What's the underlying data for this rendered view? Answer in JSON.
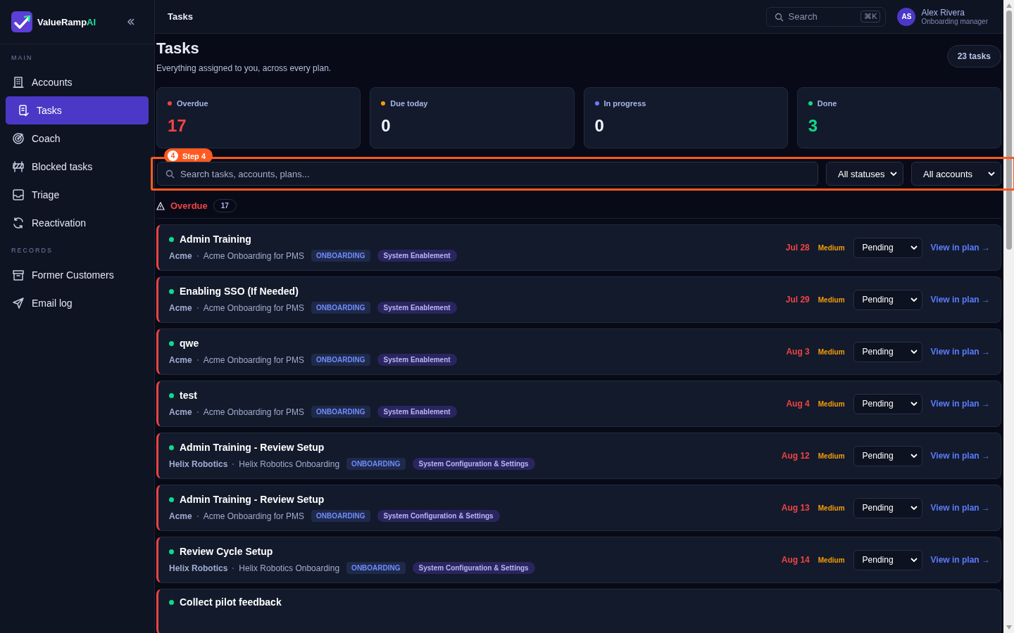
{
  "brand": {
    "name": "ValueRamp",
    "suffix": "AI"
  },
  "sidebar": {
    "sections": [
      {
        "label": "MAIN",
        "items": [
          {
            "label": "Accounts",
            "selected": false
          },
          {
            "label": "Tasks",
            "selected": true
          },
          {
            "label": "Coach",
            "selected": false
          },
          {
            "label": "Blocked tasks",
            "selected": false
          },
          {
            "label": "Triage",
            "selected": false
          },
          {
            "label": "Reactivation",
            "selected": false
          }
        ]
      },
      {
        "label": "RECORDS",
        "items": [
          {
            "label": "Former Customers",
            "selected": false
          },
          {
            "label": "Email log",
            "selected": false
          }
        ]
      }
    ]
  },
  "header": {
    "title": "Tasks",
    "search": {
      "placeholder": "Search",
      "shortcut": "⌘K"
    },
    "user": {
      "initials": "AS",
      "name": "Alex Rivera",
      "role": "Onboarding manager"
    }
  },
  "page": {
    "title": "Tasks",
    "subtitle": "Everything assigned to you, across every plan.",
    "count": "23 tasks"
  },
  "stats": [
    {
      "label": "Overdue",
      "value": "17",
      "color": "#ef4444"
    },
    {
      "label": "Due today",
      "value": "0",
      "color": "#f59e0b"
    },
    {
      "label": "In progress",
      "value": "0",
      "color": "#6b7cff"
    },
    {
      "label": "Done",
      "value": "3",
      "color": "#10d98a"
    }
  ],
  "step": {
    "number": "4",
    "label": "Step 4"
  },
  "filters": {
    "placeholder": "Search tasks, accounts, plans...",
    "status": "All statuses",
    "account": "All accounts"
  },
  "group": {
    "label": "Overdue",
    "count": "17"
  },
  "tasks": [
    {
      "title": "Admin Training",
      "account": "Acme",
      "plan": "Acme Onboarding for PMS",
      "phase": "ONBOARDING",
      "category": "System Enablement",
      "due": "Jul 28",
      "priority": "Medium",
      "status": "Pending",
      "link": "View in plan →"
    },
    {
      "title": "Enabling SSO (If Needed)",
      "account": "Acme",
      "plan": "Acme Onboarding for PMS",
      "phase": "ONBOARDING",
      "category": "System Enablement",
      "due": "Jul 29",
      "priority": "Medium",
      "status": "Pending",
      "link": "View in plan →"
    },
    {
      "title": "qwe",
      "account": "Acme",
      "plan": "Acme Onboarding for PMS",
      "phase": "ONBOARDING",
      "category": "System Enablement",
      "due": "Aug 3",
      "priority": "Medium",
      "status": "Pending",
      "link": "View in plan →"
    },
    {
      "title": "test",
      "account": "Acme",
      "plan": "Acme Onboarding for PMS",
      "phase": "ONBOARDING",
      "category": "System Enablement",
      "due": "Aug 4",
      "priority": "Medium",
      "status": "Pending",
      "link": "View in plan →"
    },
    {
      "title": "Admin Training - Review Setup",
      "account": "Helix Robotics",
      "plan": "Helix Robotics Onboarding",
      "phase": "ONBOARDING",
      "category": "System Configuration & Settings",
      "due": "Aug 12",
      "priority": "Medium",
      "status": "Pending",
      "link": "View in plan →"
    },
    {
      "title": "Admin Training - Review Setup",
      "account": "Acme",
      "plan": "Acme Onboarding for PMS",
      "phase": "ONBOARDING",
      "category": "System Configuration & Settings",
      "due": "Aug 13",
      "priority": "Medium",
      "status": "Pending",
      "link": "View in plan →"
    },
    {
      "title": "Review Cycle Setup",
      "account": "Helix Robotics",
      "plan": "Helix Robotics Onboarding",
      "phase": "ONBOARDING",
      "category": "System Configuration & Settings",
      "due": "Aug 14",
      "priority": "Medium",
      "status": "Pending",
      "link": "View in plan →"
    },
    {
      "title": "Collect pilot feedback"
    }
  ]
}
